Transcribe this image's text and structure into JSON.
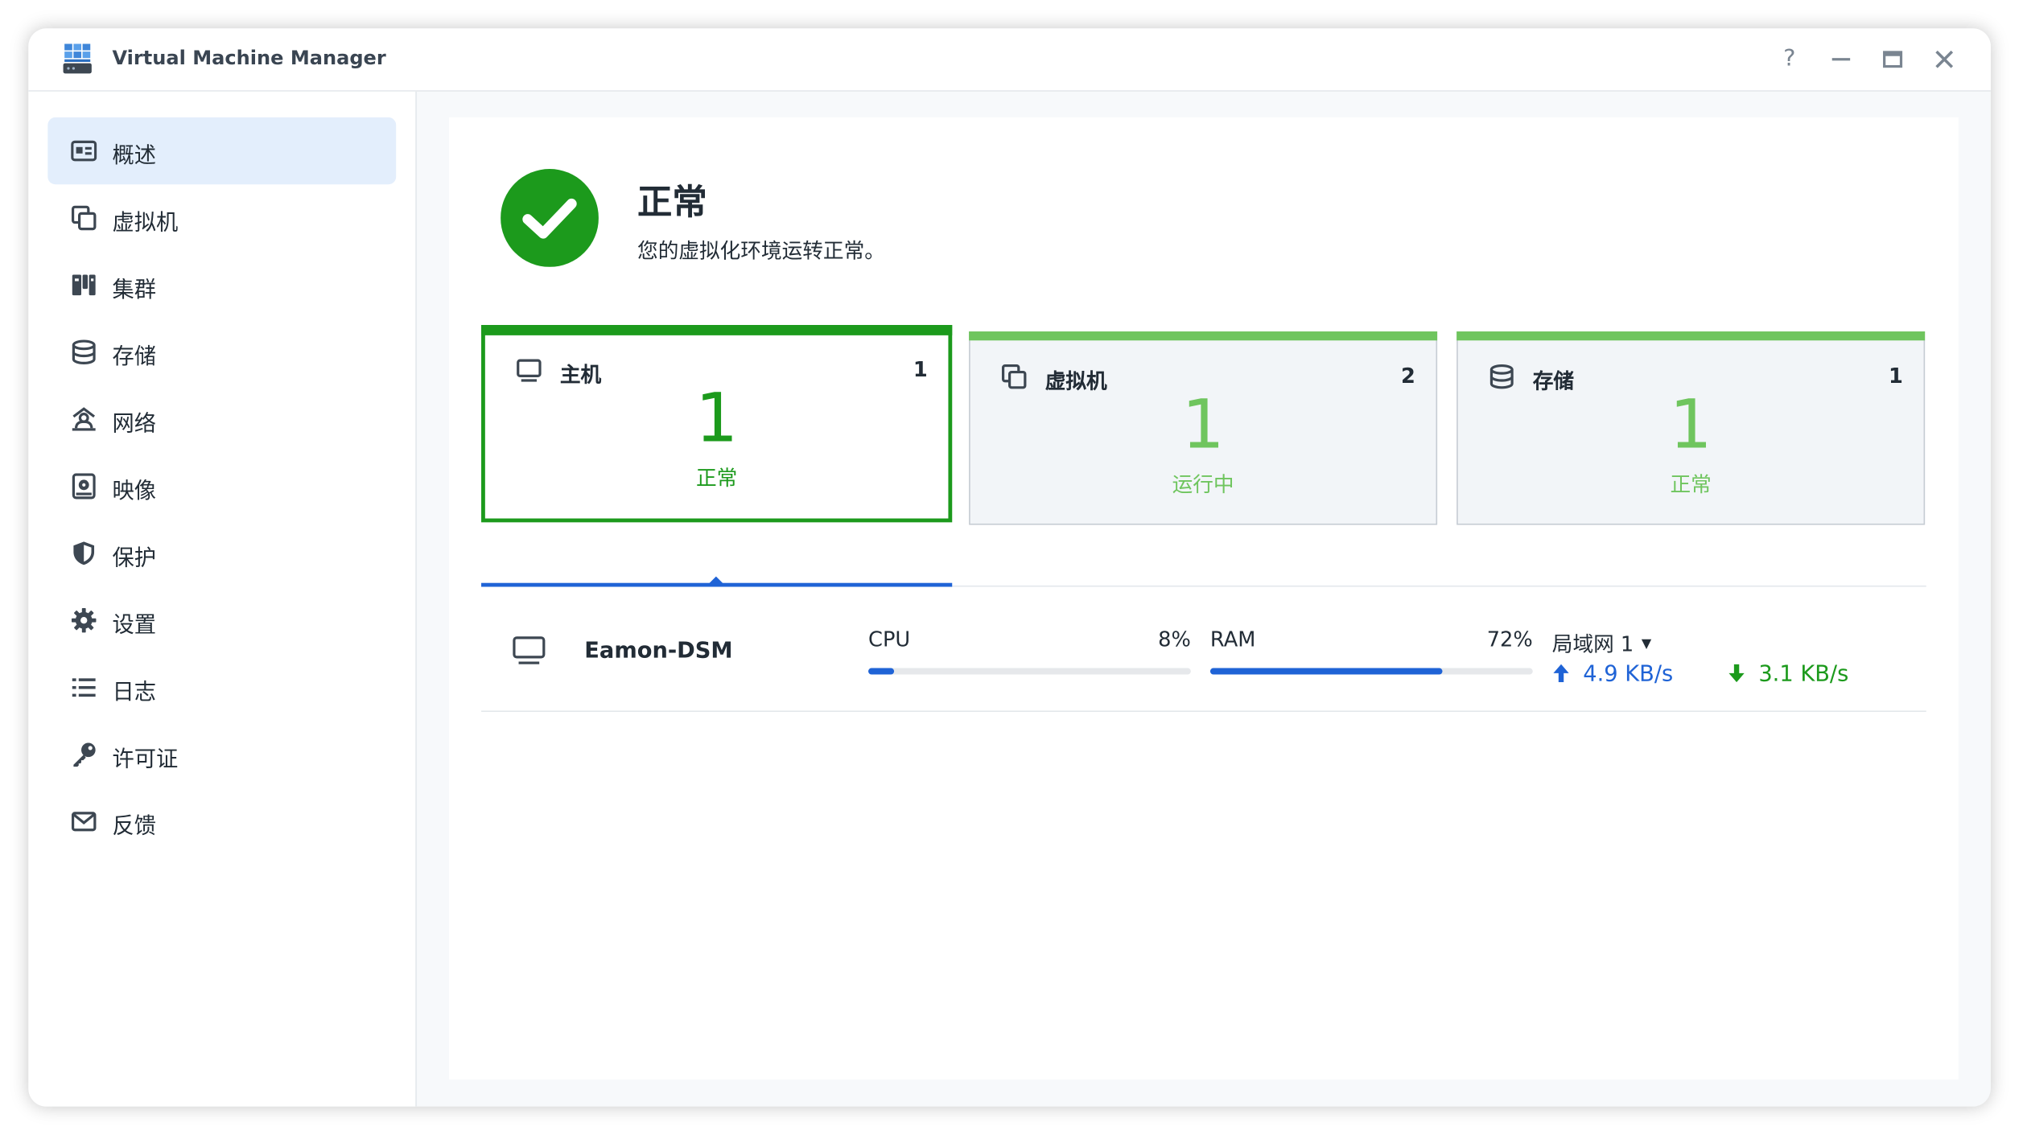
{
  "app": {
    "title": "Virtual Machine Manager",
    "icon": "vmm-app-icon"
  },
  "window_controls": {
    "help": "?",
    "minimize": "—",
    "maximize": "▭",
    "close": "✕"
  },
  "sidebar": {
    "items": [
      {
        "label": "概述",
        "icon": "overview-icon",
        "active": true
      },
      {
        "label": "虚拟机",
        "icon": "virtual-machine-icon"
      },
      {
        "label": "集群",
        "icon": "cluster-icon"
      },
      {
        "label": "存储",
        "icon": "storage-icon"
      },
      {
        "label": "网络",
        "icon": "network-icon"
      },
      {
        "label": "映像",
        "icon": "image-icon"
      },
      {
        "label": "保护",
        "icon": "shield-icon"
      },
      {
        "label": "设置",
        "icon": "gear-icon"
      },
      {
        "label": "日志",
        "icon": "log-list-icon"
      },
      {
        "label": "许可证",
        "icon": "key-icon"
      },
      {
        "label": "反馈",
        "icon": "mail-icon"
      }
    ]
  },
  "status": {
    "title": "正常",
    "description": "您的虚拟化环境运转正常。",
    "icon": "check-circle-icon"
  },
  "cards": [
    {
      "label": "主机",
      "count": "1",
      "big": "1",
      "status": "正常",
      "icon": "monitor-icon",
      "selected": true
    },
    {
      "label": "虚拟机",
      "count": "2",
      "big": "1",
      "status": "运行中",
      "icon": "virtual-machine-icon"
    },
    {
      "label": "存储",
      "count": "1",
      "big": "1",
      "status": "正常",
      "icon": "storage-icon"
    }
  ],
  "host": {
    "name": "Eamon-DSM",
    "icon": "monitor-icon",
    "cpu_label": "CPU",
    "cpu_value": "8%",
    "cpu_percent": 8,
    "ram_label": "RAM",
    "ram_value": "72%",
    "ram_percent": 72,
    "lan_label": "局域网 1",
    "upload": "4.9 KB/s",
    "download": "3.1 KB/s"
  },
  "colors": {
    "accent_blue": "#1f63d6",
    "healthy_green": "#1c9a1c",
    "light_green": "#6fc55e",
    "sidebar_active": "#e3eefc"
  }
}
